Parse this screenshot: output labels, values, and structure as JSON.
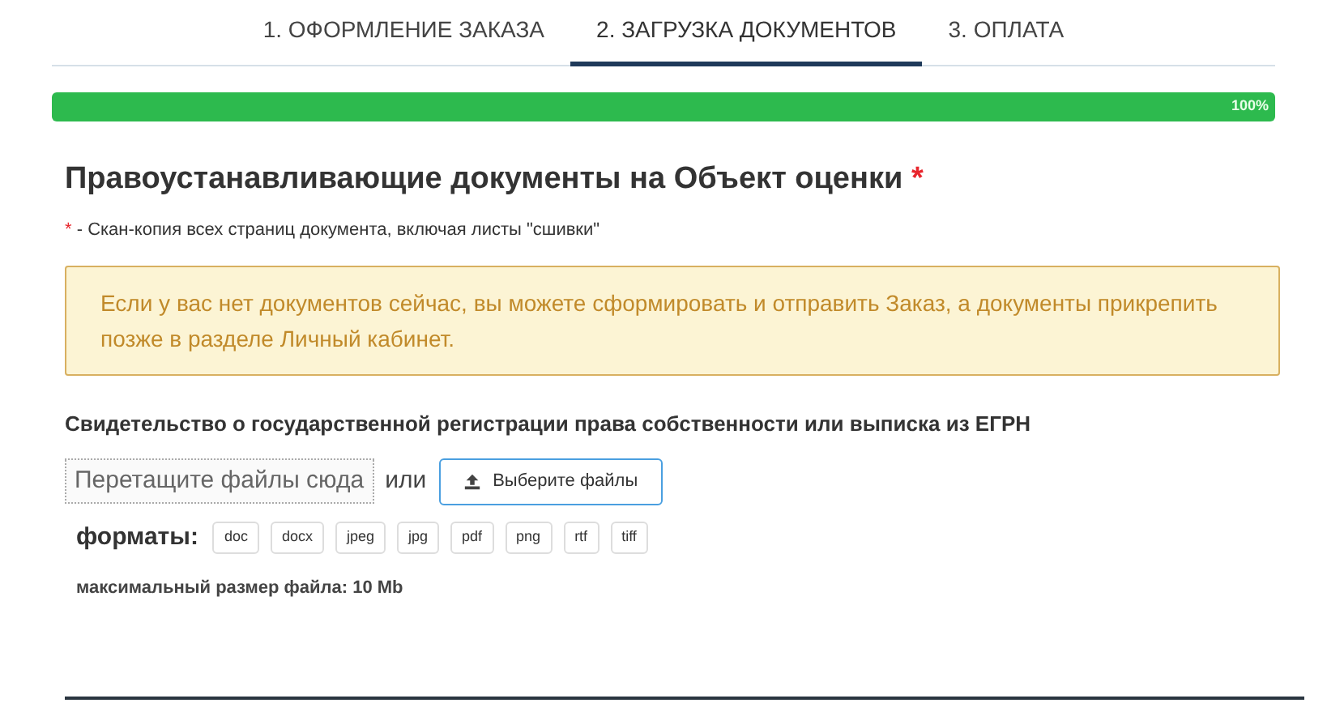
{
  "tabs": [
    {
      "label": "1. ОФОРМЛЕНИЕ ЗАКАЗА",
      "selected": false
    },
    {
      "label": "2. ЗАГРУЗКА ДОКУМЕНТОВ",
      "selected": true
    },
    {
      "label": "3. ОПЛАТА",
      "selected": false
    }
  ],
  "progress": {
    "level": 1,
    "reading": "100%"
  },
  "heading": {
    "text": "Правоустанавливающие документы на Объект оценки",
    "required_mark": "*"
  },
  "note": {
    "mark": "*",
    "text": "- Скан-копия всех страниц документа, включая листы \"сшивки\""
  },
  "alert": "Если у вас нет документов сейчас, вы можете сформировать и отправить Заказ, а документы прикрепить позже в разделе Личный кабинет.",
  "document": {
    "title": "Свидетельство о государственной регистрации права собственности или выписка из ЕГРН",
    "dropzone": "Перетащите файлы сюда",
    "or": "или",
    "button": "Выберите файлы",
    "formats_label": "форматы:",
    "formats": [
      "doc",
      "docx",
      "jpeg",
      "jpg",
      "pdf",
      "png",
      "rtf",
      "tiff"
    ],
    "max_size": "максимальный размер файла: 10 Mb"
  }
}
